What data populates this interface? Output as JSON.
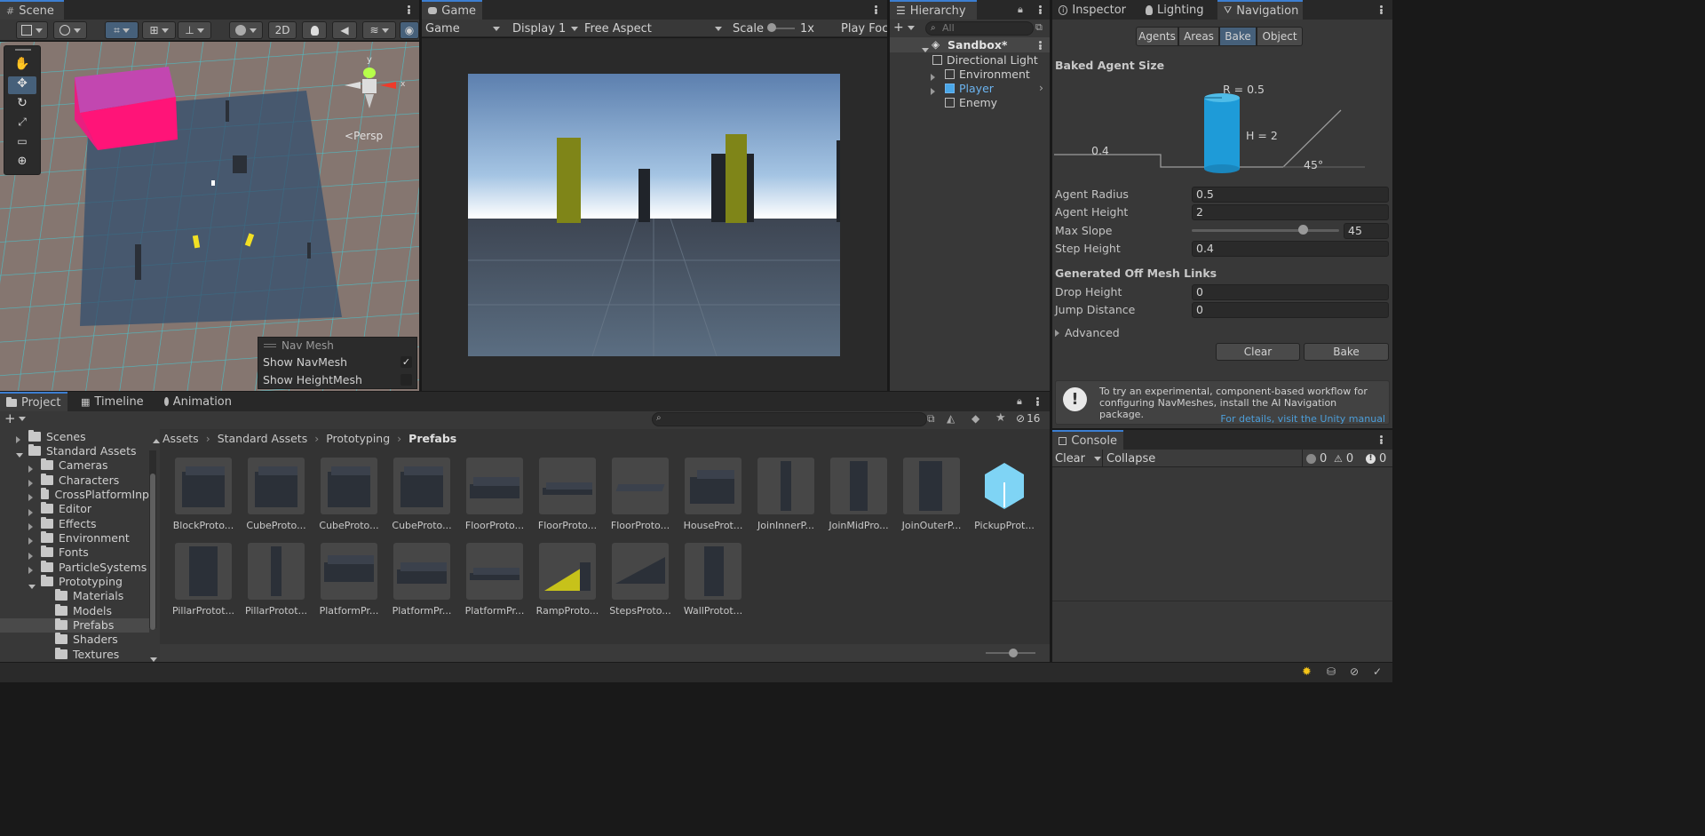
{
  "tabs": {
    "scene": "Scene",
    "game": "Game",
    "hierarchy": "Hierarchy",
    "inspector": "Inspector",
    "lighting": "Lighting",
    "navigation": "Navigation",
    "project": "Project",
    "timeline": "Timeline",
    "animation": "Animation",
    "console": "Console"
  },
  "scene": {
    "mode_2d": "2D",
    "persp_label": "Persp",
    "gizmo_axis_y": "y",
    "gizmo_axis_x": "x",
    "navmesh_overlay": {
      "title": "Nav Mesh",
      "show_navmesh": "Show NavMesh",
      "show_navmesh_checked": true,
      "show_heightmesh": "Show HeightMesh",
      "show_heightmesh_checked": false
    }
  },
  "game": {
    "mode": "Game",
    "display": "Display 1",
    "aspect": "Free Aspect",
    "scale_label": "Scale",
    "scale_value": "1x",
    "play_focus": "Play Foc"
  },
  "hierarchy": {
    "search_placeholder": "All",
    "scene_name": "Sandbox*",
    "items": [
      {
        "label": "Directional Light"
      },
      {
        "label": "Environment"
      },
      {
        "label": "Player"
      },
      {
        "label": "Enemy"
      }
    ]
  },
  "navigation": {
    "subtabs": [
      "Agents",
      "Areas",
      "Bake",
      "Object"
    ],
    "active_subtab": "Bake",
    "section_title": "Baked Agent Size",
    "diagram": {
      "radius": "R = 0.5",
      "height": "H = 2",
      "step": "0.4",
      "slope": "45°"
    },
    "fields": {
      "agent_radius_label": "Agent Radius",
      "agent_radius": "0.5",
      "agent_height_label": "Agent Height",
      "agent_height": "2",
      "max_slope_label": "Max Slope",
      "max_slope": "45",
      "max_slope_fraction": 0.75,
      "step_height_label": "Step Height",
      "step_height": "0.4"
    },
    "offmesh_title": "Generated Off Mesh Links",
    "drop_height_label": "Drop Height",
    "drop_height": "0",
    "jump_distance_label": "Jump Distance",
    "jump_distance": "0",
    "advanced": "Advanced",
    "clear_button": "Clear",
    "bake_button": "Bake",
    "info_text": "To try an experimental, component-based workflow for configuring NavMeshes, install the AI Navigation package.",
    "info_link": "For details, visit the Unity manual"
  },
  "project": {
    "tree": [
      {
        "label": "Scenes",
        "expanded": false
      },
      {
        "label": "Standard Assets",
        "expanded": true
      },
      {
        "label": "Cameras",
        "expanded": false
      },
      {
        "label": "Characters",
        "expanded": false
      },
      {
        "label": "CrossPlatformInp",
        "expanded": false
      },
      {
        "label": "Editor",
        "expanded": false
      },
      {
        "label": "Effects",
        "expanded": false
      },
      {
        "label": "Environment",
        "expanded": false
      },
      {
        "label": "Fonts",
        "expanded": false
      },
      {
        "label": "ParticleSystems",
        "expanded": false
      },
      {
        "label": "Prototyping",
        "expanded": true
      },
      {
        "label": "Materials"
      },
      {
        "label": "Models"
      },
      {
        "label": "Prefabs"
      },
      {
        "label": "Shaders"
      },
      {
        "label": "Textures"
      }
    ],
    "breadcrumb": [
      "Assets",
      "Standard Assets",
      "Prototyping",
      "Prefabs"
    ],
    "hidden_count": "16",
    "assets": [
      {
        "name": "BlockProto...",
        "shape": "cube"
      },
      {
        "name": "CubeProto...",
        "shape": "cube"
      },
      {
        "name": "CubeProto...",
        "shape": "cube"
      },
      {
        "name": "CubeProto...",
        "shape": "cube"
      },
      {
        "name": "FloorProto...",
        "shape": "slab"
      },
      {
        "name": "FloorProto...",
        "shape": "slab-thin"
      },
      {
        "name": "FloorProto...",
        "shape": "plane"
      },
      {
        "name": "HouseProt...",
        "shape": "house"
      },
      {
        "name": "JoinInnerP...",
        "shape": "pillar"
      },
      {
        "name": "JoinMidPro...",
        "shape": "pillar-wide"
      },
      {
        "name": "JoinOuterP...",
        "shape": "pillar-wider"
      },
      {
        "name": "PickupProt...",
        "shape": "pickup"
      },
      {
        "name": "PillarProtot...",
        "shape": "tall"
      },
      {
        "name": "PillarProtot...",
        "shape": "pillar"
      },
      {
        "name": "PlatformPr...",
        "shape": "platform"
      },
      {
        "name": "PlatformPr...",
        "shape": "slab"
      },
      {
        "name": "PlatformPr...",
        "shape": "slab-thin"
      },
      {
        "name": "RampProto...",
        "shape": "ramp"
      },
      {
        "name": "StepsProto...",
        "shape": "steps"
      },
      {
        "name": "WallProtot...",
        "shape": "wall"
      }
    ]
  },
  "console": {
    "clear": "Clear",
    "collapse": "Collapse",
    "info_count": "0",
    "warn_count": "0",
    "error_count": "0"
  },
  "colors": {
    "accent": "#3c7ed1",
    "selected": "#2c5d87",
    "link": "#4c9ed9",
    "player_blue": "#6cb4f0"
  }
}
